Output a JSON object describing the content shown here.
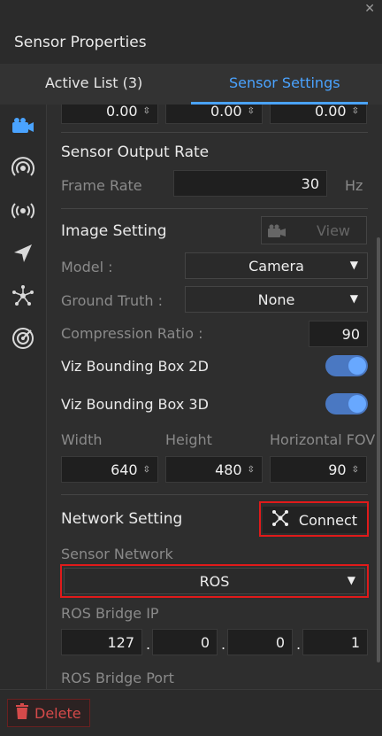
{
  "window": {
    "title": "Sensor Properties",
    "close_icon": "close-icon"
  },
  "tabs": [
    {
      "label": "Active List  (3)",
      "active": false
    },
    {
      "label": "Sensor Settings",
      "active": true
    }
  ],
  "sidebar": {
    "icons": [
      "camera-icon",
      "radar-icon",
      "broadcast-icon",
      "navigation-arrow-icon",
      "network-node-icon",
      "target-radar-icon"
    ],
    "active_index": 0
  },
  "top_fields": [
    "0.00",
    "0.00",
    "0.00"
  ],
  "output_rate": {
    "title": "Sensor Output Rate",
    "frame_rate_label": "Frame Rate",
    "frame_rate_value": "30",
    "unit": "Hz"
  },
  "image_setting": {
    "title": "Image Setting",
    "view_label": "View",
    "model_label": "Model :",
    "model_value": "Camera",
    "ground_truth_label": "Ground Truth :",
    "ground_truth_value": "None",
    "compression_label": "Compression Ratio :",
    "compression_value": "90",
    "bbox2d_label": "Viz Bounding Box 2D",
    "bbox2d_on": true,
    "bbox3d_label": "Viz Bounding Box 3D",
    "bbox3d_on": true,
    "width_label": "Width",
    "height_label": "Height",
    "fov_label": "Horizontal FOV",
    "width_value": "640",
    "height_value": "480",
    "fov_value": "90"
  },
  "network_setting": {
    "title": "Network Setting",
    "connect_label": "Connect",
    "sensor_network_label": "Sensor Network",
    "sensor_network_value": "ROS",
    "ros_bridge_ip_label": "ROS Bridge IP",
    "ip": [
      "127",
      "0",
      "0",
      "1"
    ],
    "ros_bridge_port_label": "ROS Bridge Port"
  },
  "footer": {
    "delete_label": "Delete"
  },
  "colors": {
    "accent": "#4aa3ff",
    "highlight": "#e01a1a",
    "danger": "#d64a4a"
  }
}
